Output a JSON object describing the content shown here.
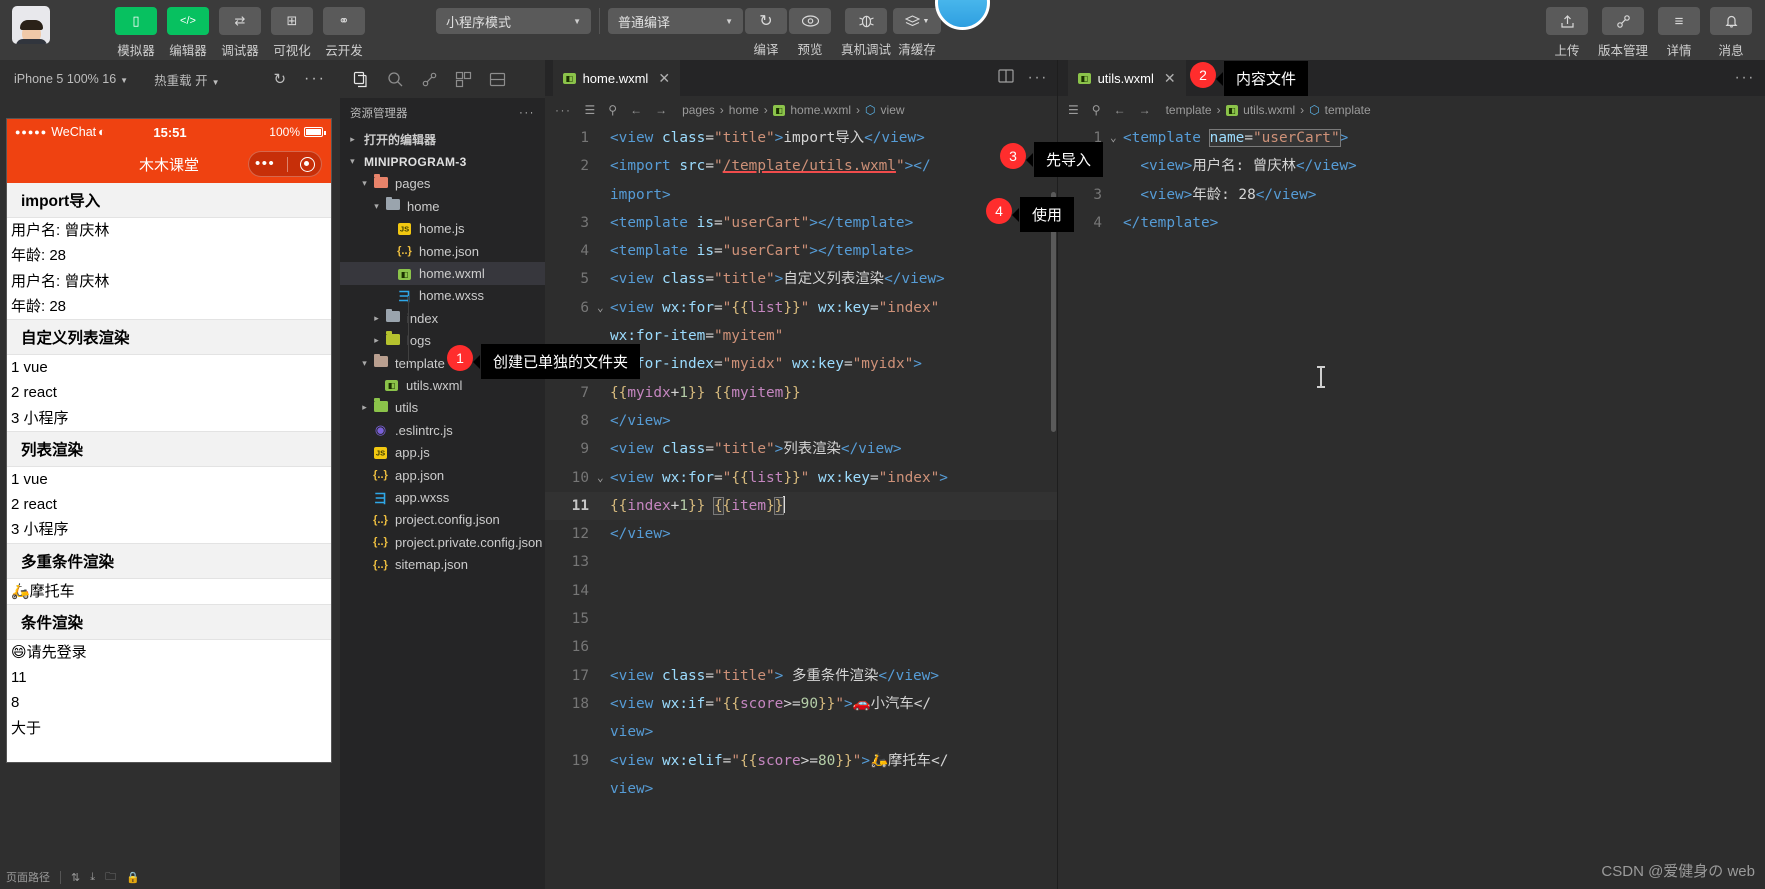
{
  "toolbar": {
    "avatar_name": "user-avatar",
    "buttons": [
      {
        "label": "模拟器",
        "icon": "phone-icon",
        "green": true,
        "glyph": "▯"
      },
      {
        "label": "编辑器",
        "icon": "code-icon",
        "green": true,
        "glyph": "</>"
      },
      {
        "label": "调试器",
        "icon": "debugger-icon",
        "green": false,
        "glyph": "⇄"
      },
      {
        "label": "可视化",
        "icon": "layout-icon",
        "green": false,
        "glyph": "⊞"
      },
      {
        "label": "云开发",
        "icon": "cloud-icon",
        "green": false,
        "glyph": "☁"
      }
    ],
    "mode_select": "小程序模式",
    "compile_select": "普通编译",
    "actions": [
      {
        "label": "编译",
        "icon": "refresh-icon",
        "glyph": "↻"
      },
      {
        "label": "预览",
        "icon": "eye-icon",
        "glyph": "👁"
      },
      {
        "label": "真机调试",
        "icon": "bug-icon",
        "glyph": "🐞"
      },
      {
        "label": "清缓存",
        "icon": "layers-icon",
        "glyph": "❒"
      }
    ],
    "right_actions": [
      {
        "label": "上传",
        "icon": "upload-icon",
        "glyph": "⬆"
      },
      {
        "label": "版本管理",
        "icon": "branch-icon",
        "glyph": "⑂"
      },
      {
        "label": "详情",
        "icon": "menu-icon",
        "glyph": "≡"
      },
      {
        "label": "消息",
        "icon": "bell-icon",
        "glyph": "🔔"
      }
    ]
  },
  "simulator": {
    "device": "iPhone 5 100% 16",
    "hotreload": "热重载 开",
    "refresh_icon": "refresh-icon",
    "more_icon": "more-icon",
    "phone": {
      "carrier": "WeChat",
      "time": "15:51",
      "battery": "100%",
      "nav_title": "木木课堂",
      "sections": [
        {
          "title": "import导入",
          "rows": [
            "用户名: 曾庆林",
            "年龄: 28",
            "用户名: 曾庆林",
            "年龄: 28"
          ]
        },
        {
          "title": "自定义列表渲染",
          "rows": [
            "1 vue",
            "2 react",
            "3 小程序"
          ]
        },
        {
          "title": "列表渲染",
          "rows": [
            "1 vue",
            "2 react",
            "3 小程序"
          ]
        },
        {
          "title": "多重条件渲染",
          "rows": [
            "🛵摩托车"
          ]
        },
        {
          "title": "条件渲染",
          "rows": [
            "😄请先登录",
            "11",
            "8",
            "大于"
          ]
        }
      ]
    },
    "bottom_bar": "页面路径"
  },
  "explorer": {
    "activity_icons": [
      "files-icon",
      "search-icon",
      "source-control-icon",
      "extensions-icon",
      "split-icon"
    ],
    "title": "资源管理器",
    "more_icon": "more-icon",
    "tree": [
      {
        "label": "打开的编辑器",
        "depth": 0,
        "arrow": "▸",
        "kind": "section"
      },
      {
        "label": "MINIPROGRAM-3",
        "depth": 0,
        "arrow": "▾",
        "kind": "root"
      },
      {
        "label": "pages",
        "depth": 1,
        "arrow": "▾",
        "kind": "folder-pink"
      },
      {
        "label": "home",
        "depth": 2,
        "arrow": "▾",
        "kind": "folder-gray"
      },
      {
        "label": "home.js",
        "depth": 3,
        "arrow": "",
        "kind": "js"
      },
      {
        "label": "home.json",
        "depth": 3,
        "arrow": "",
        "kind": "json"
      },
      {
        "label": "home.wxml",
        "depth": 3,
        "arrow": "",
        "kind": "wxml",
        "selected": true
      },
      {
        "label": "home.wxss",
        "depth": 3,
        "arrow": "",
        "kind": "wxss"
      },
      {
        "label": "index",
        "depth": 2,
        "arrow": "▸",
        "kind": "folder-gray"
      },
      {
        "label": "logs",
        "depth": 2,
        "arrow": "▸",
        "kind": "folder-yellow"
      },
      {
        "label": "template",
        "depth": 1,
        "arrow": "▾",
        "kind": "folder-tan"
      },
      {
        "label": "utils.wxml",
        "depth": 2,
        "arrow": "",
        "kind": "wxml"
      },
      {
        "label": "utils",
        "depth": 1,
        "arrow": "▸",
        "kind": "folder-green"
      },
      {
        "label": ".eslintrc.js",
        "depth": 1,
        "arrow": "",
        "kind": "eslint"
      },
      {
        "label": "app.js",
        "depth": 1,
        "arrow": "",
        "kind": "js"
      },
      {
        "label": "app.json",
        "depth": 1,
        "arrow": "",
        "kind": "json"
      },
      {
        "label": "app.wxss",
        "depth": 1,
        "arrow": "",
        "kind": "wxss"
      },
      {
        "label": "project.config.json",
        "depth": 1,
        "arrow": "",
        "kind": "json"
      },
      {
        "label": "project.private.config.json",
        "depth": 1,
        "arrow": "",
        "kind": "json"
      },
      {
        "label": "sitemap.json",
        "depth": 1,
        "arrow": "",
        "kind": "json"
      }
    ]
  },
  "editor_left": {
    "tab": {
      "name": "home.wxml",
      "icon": "wxml-icon",
      "close": "✕"
    },
    "tab_right_icons": [
      "split-editor-icon",
      "more-icon"
    ],
    "breadcrumb_tools": [
      "outline-icon",
      "bookmark-icon",
      "back-arrow-icon",
      "forward-arrow-icon"
    ],
    "breadcrumb": [
      "pages",
      "home",
      "home.wxml",
      "view"
    ],
    "lines": [
      {
        "n": "1",
        "fold": "",
        "html": "<span class='k-tag'>&lt;view</span> <span class='k-attr'>class</span>=<span class='k-str'>\"title\"</span><span class='k-tag'>&gt;</span><span class='k-txt'>import导入</span><span class='k-tag'>&lt;/view&gt;</span>"
      },
      {
        "n": "2",
        "fold": "",
        "html": "<span class='k-tag'>&lt;import</span> <span class='k-attr'>src</span>=<span class='k-str'>\"</span><span class='k-str underline-err'>/template/utils.wxml</span><span class='k-str'>\"</span><span class='k-tag'>&gt;&lt;/</span>"
      },
      {
        "n": "",
        "fold": "",
        "html": "<span class='k-tag'>import&gt;</span>"
      },
      {
        "n": "3",
        "fold": "",
        "html": "<span class='k-tag'>&lt;template</span> <span class='k-attr'>is</span>=<span class='k-str'>\"userCart\"</span><span class='k-tag'>&gt;&lt;/template&gt;</span>"
      },
      {
        "n": "4",
        "fold": "",
        "html": "<span class='k-tag'>&lt;template</span> <span class='k-attr'>is</span>=<span class='k-str'>\"userCart\"</span><span class='k-tag'>&gt;&lt;/template&gt;</span>"
      },
      {
        "n": "5",
        "fold": "",
        "html": "<span class='k-tag'>&lt;view</span> <span class='k-attr'>class</span>=<span class='k-str'>\"title\"</span><span class='k-tag'>&gt;</span><span class='k-txt'>自定义列表渲染</span><span class='k-tag'>&lt;/view&gt;</span>"
      },
      {
        "n": "6",
        "fold": "⌄",
        "html": "<span class='k-tag'>&lt;view</span> <span class='k-attr'>wx:for</span>=<span class='k-str'>\"</span><span class='k-brc'>{{</span><span class='k-var'>list</span><span class='k-brc'>}}</span><span class='k-str'>\"</span> <span class='k-attr'>wx:key</span>=<span class='k-str'>\"index\"</span>"
      },
      {
        "n": "",
        "fold": "",
        "html": "<span class='k-attr'>wx:for-item</span>=<span class='k-str'>\"myitem\"</span>"
      },
      {
        "n": "",
        "fold": "",
        "html": "<span class='k-attr'>wx:for-index</span>=<span class='k-str'>\"myidx\"</span> <span class='k-attr'>wx:key</span>=<span class='k-str'>\"myidx\"</span><span class='k-tag'>&gt;</span>"
      },
      {
        "n": "7",
        "fold": "",
        "html": "<span class='k-brc'>{{</span><span class='k-var'>myidx</span><span class='k-op'>+</span><span class='k-num'>1</span><span class='k-brc'>}}</span> <span class='k-brc'>{{</span><span class='k-var'>myitem</span><span class='k-brc'>}}</span>"
      },
      {
        "n": "8",
        "fold": "",
        "html": "<span class='k-tag'>&lt;/view&gt;</span>"
      },
      {
        "n": "9",
        "fold": "",
        "html": "<span class='k-tag'>&lt;view</span> <span class='k-attr'>class</span>=<span class='k-str'>\"title\"</span><span class='k-tag'>&gt;</span><span class='k-txt'>列表渲染</span><span class='k-tag'>&lt;/view&gt;</span>"
      },
      {
        "n": "10",
        "fold": "⌄",
        "html": "<span class='k-tag'>&lt;view</span> <span class='k-attr'>wx:for</span>=<span class='k-str'>\"</span><span class='k-brc'>{{</span><span class='k-var'>list</span><span class='k-brc'>}}</span><span class='k-str'>\"</span> <span class='k-attr'>wx:key</span>=<span class='k-str'>\"index\"</span><span class='k-tag'>&gt;</span>"
      },
      {
        "n": "11",
        "fold": "",
        "cur": true,
        "html": "<span class='k-brc'>{{</span><span class='k-var'>index</span><span class='k-op'>+</span><span class='k-num'>1</span><span class='k-brc'>}}</span> <span class='sel-box k-brc'>{</span><span class='k-brc'>{</span><span class='k-var'>item</span><span class='k-brc'>}</span><span class='sel-box k-brc'>}</span><span class='cursor-bar'></span>"
      },
      {
        "n": "12",
        "fold": "",
        "html": "<span class='k-tag'>&lt;/view&gt;</span>"
      },
      {
        "n": "13",
        "fold": "",
        "html": ""
      },
      {
        "n": "14",
        "fold": "",
        "html": ""
      },
      {
        "n": "15",
        "fold": "",
        "html": ""
      },
      {
        "n": "16",
        "fold": "",
        "html": ""
      },
      {
        "n": "17",
        "fold": "",
        "html": "<span class='k-tag'>&lt;view</span> <span class='k-attr'>class</span>=<span class='k-str'>\"title\"</span><span class='k-tag'>&gt;</span><span class='k-txt'> 多重条件渲染</span><span class='k-tag'>&lt;/view&gt;</span>"
      },
      {
        "n": "18",
        "fold": "",
        "html": "<span class='k-tag'>&lt;view</span> <span class='k-attr'>wx:if</span>=<span class='k-str'>\"</span><span class='k-brc'>{{</span><span class='k-var'>score</span><span class='k-op'>&gt;=</span><span class='k-num'>90</span><span class='k-brc'>}}</span><span class='k-str'>\"</span><span class='k-tag'>&gt;</span><span class='k-txt'>🚗小汽车&lt;/</span>"
      },
      {
        "n": "",
        "fold": "",
        "html": "<span class='k-tag'>view&gt;</span>"
      },
      {
        "n": "19",
        "fold": "",
        "html": "<span class='k-tag'>&lt;view</span> <span class='k-attr'>wx:elif</span>=<span class='k-str'>\"</span><span class='k-brc'>{{</span><span class='k-var'>score</span><span class='k-op'>&gt;=</span><span class='k-num'>80</span><span class='k-brc'>}}</span><span class='k-str'>\"</span><span class='k-tag'>&gt;</span><span class='k-txt'>🛵摩托车&lt;/</span>"
      },
      {
        "n": "",
        "fold": "",
        "html": "<span class='k-tag'>view&gt;</span>"
      }
    ]
  },
  "editor_right": {
    "tab": {
      "name": "utils.wxml",
      "icon": "wxml-icon",
      "close": "✕"
    },
    "tab_right_icons": [
      "more-icon"
    ],
    "breadcrumb_tools": [
      "outline-icon",
      "bookmark-icon",
      "back-arrow-icon",
      "forward-arrow-icon"
    ],
    "breadcrumb": [
      "template",
      "utils.wxml",
      "template"
    ],
    "lines": [
      {
        "n": "1",
        "fold": "⌄",
        "html": "<span class='k-tag'>&lt;template</span> <span class='sel-box'><span class='k-attr'>name</span>=<span class='k-str'>\"userCart\"</span></span><span class='k-tag'>&gt;</span>"
      },
      {
        "n": "2",
        "fold": "",
        "html": "  <span class='k-tag'>&lt;view&gt;</span><span class='k-txt'>用户名: 曾庆林</span><span class='k-tag'>&lt;/view&gt;</span>"
      },
      {
        "n": "3",
        "fold": "",
        "html": "  <span class='k-tag'>&lt;view&gt;</span><span class='k-txt'>年龄: 28</span><span class='k-tag'>&lt;/view&gt;</span>"
      },
      {
        "n": "4",
        "fold": "",
        "html": "<span class='k-tag'>&lt;/template&gt;</span>"
      }
    ]
  },
  "callouts": [
    {
      "num": "1",
      "text": "创建已单独的文件夹"
    },
    {
      "num": "2",
      "text": "内容文件"
    },
    {
      "num": "3",
      "text": "先导入"
    },
    {
      "num": "4",
      "text": "使用"
    }
  ],
  "watermark": "CSDN @爱健身の web"
}
